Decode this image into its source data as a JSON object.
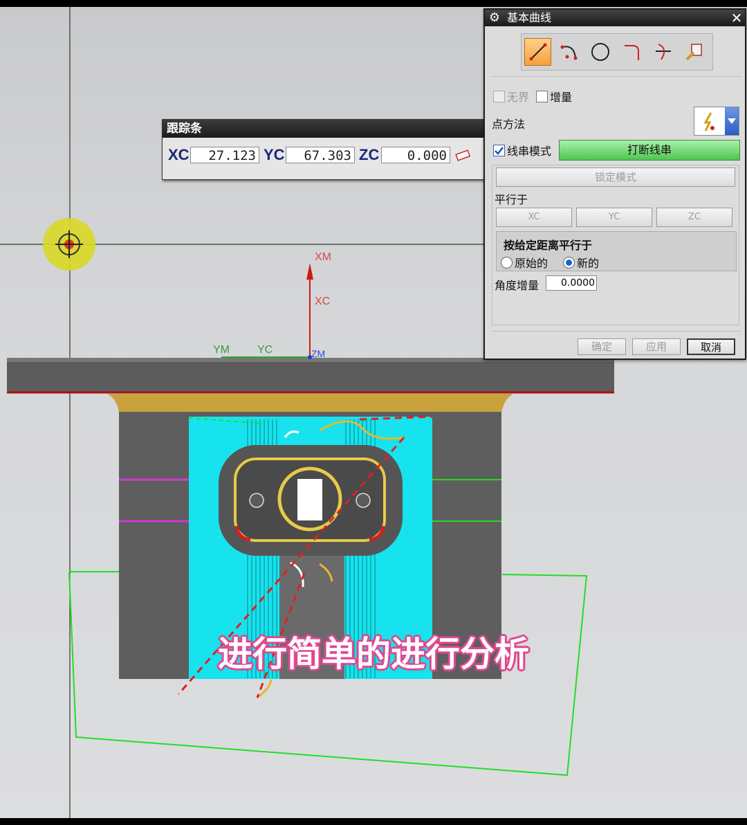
{
  "tracking_bar": {
    "title": "跟踪条",
    "xc_label": "XC",
    "xc_value": "27.123",
    "yc_label": "YC",
    "yc_value": "67.303",
    "zc_label": "ZC",
    "zc_value": "0.000"
  },
  "axes": {
    "xm": "XM",
    "xc": "XC",
    "ym": "YM",
    "yc": "YC",
    "zm": "ZM"
  },
  "dialog": {
    "title": "基本曲线",
    "curve_icons": [
      "line-icon",
      "arc-icon",
      "circle-icon",
      "fillet-icon",
      "trim-icon",
      "edit-curve-params-icon"
    ],
    "unbounded_label": "无界",
    "unbounded_checked": false,
    "increment_label": "增量",
    "increment_checked": false,
    "point_method_label": "点方法",
    "string_mode_label": "线串模式",
    "string_mode_checked": true,
    "break_string_button": "打断线串",
    "lock_mode_button": "锁定模式",
    "parallel_to_label": "平行于",
    "parallel_xc": "XC",
    "parallel_yc": "YC",
    "parallel_zc": "ZC",
    "parallel_distance_group": "按给定距离平行于",
    "original_label": "原始的",
    "new_label": "新的",
    "selected_option": "新的",
    "angle_increment_label": "角度增量",
    "angle_increment_value": "0.0000",
    "ok_button": "确定",
    "apply_button": "应用",
    "cancel_button": "取消"
  },
  "subtitle": "进行简单的进行分析",
  "colors": {
    "cyan_face": "#16e3ee",
    "green_wire": "#22dd22",
    "magenta_edge": "#d23ad2",
    "red_dashed": "#e02020",
    "gold_fillet": "#c9a23c",
    "accent_green_button": "#5fd15f"
  }
}
